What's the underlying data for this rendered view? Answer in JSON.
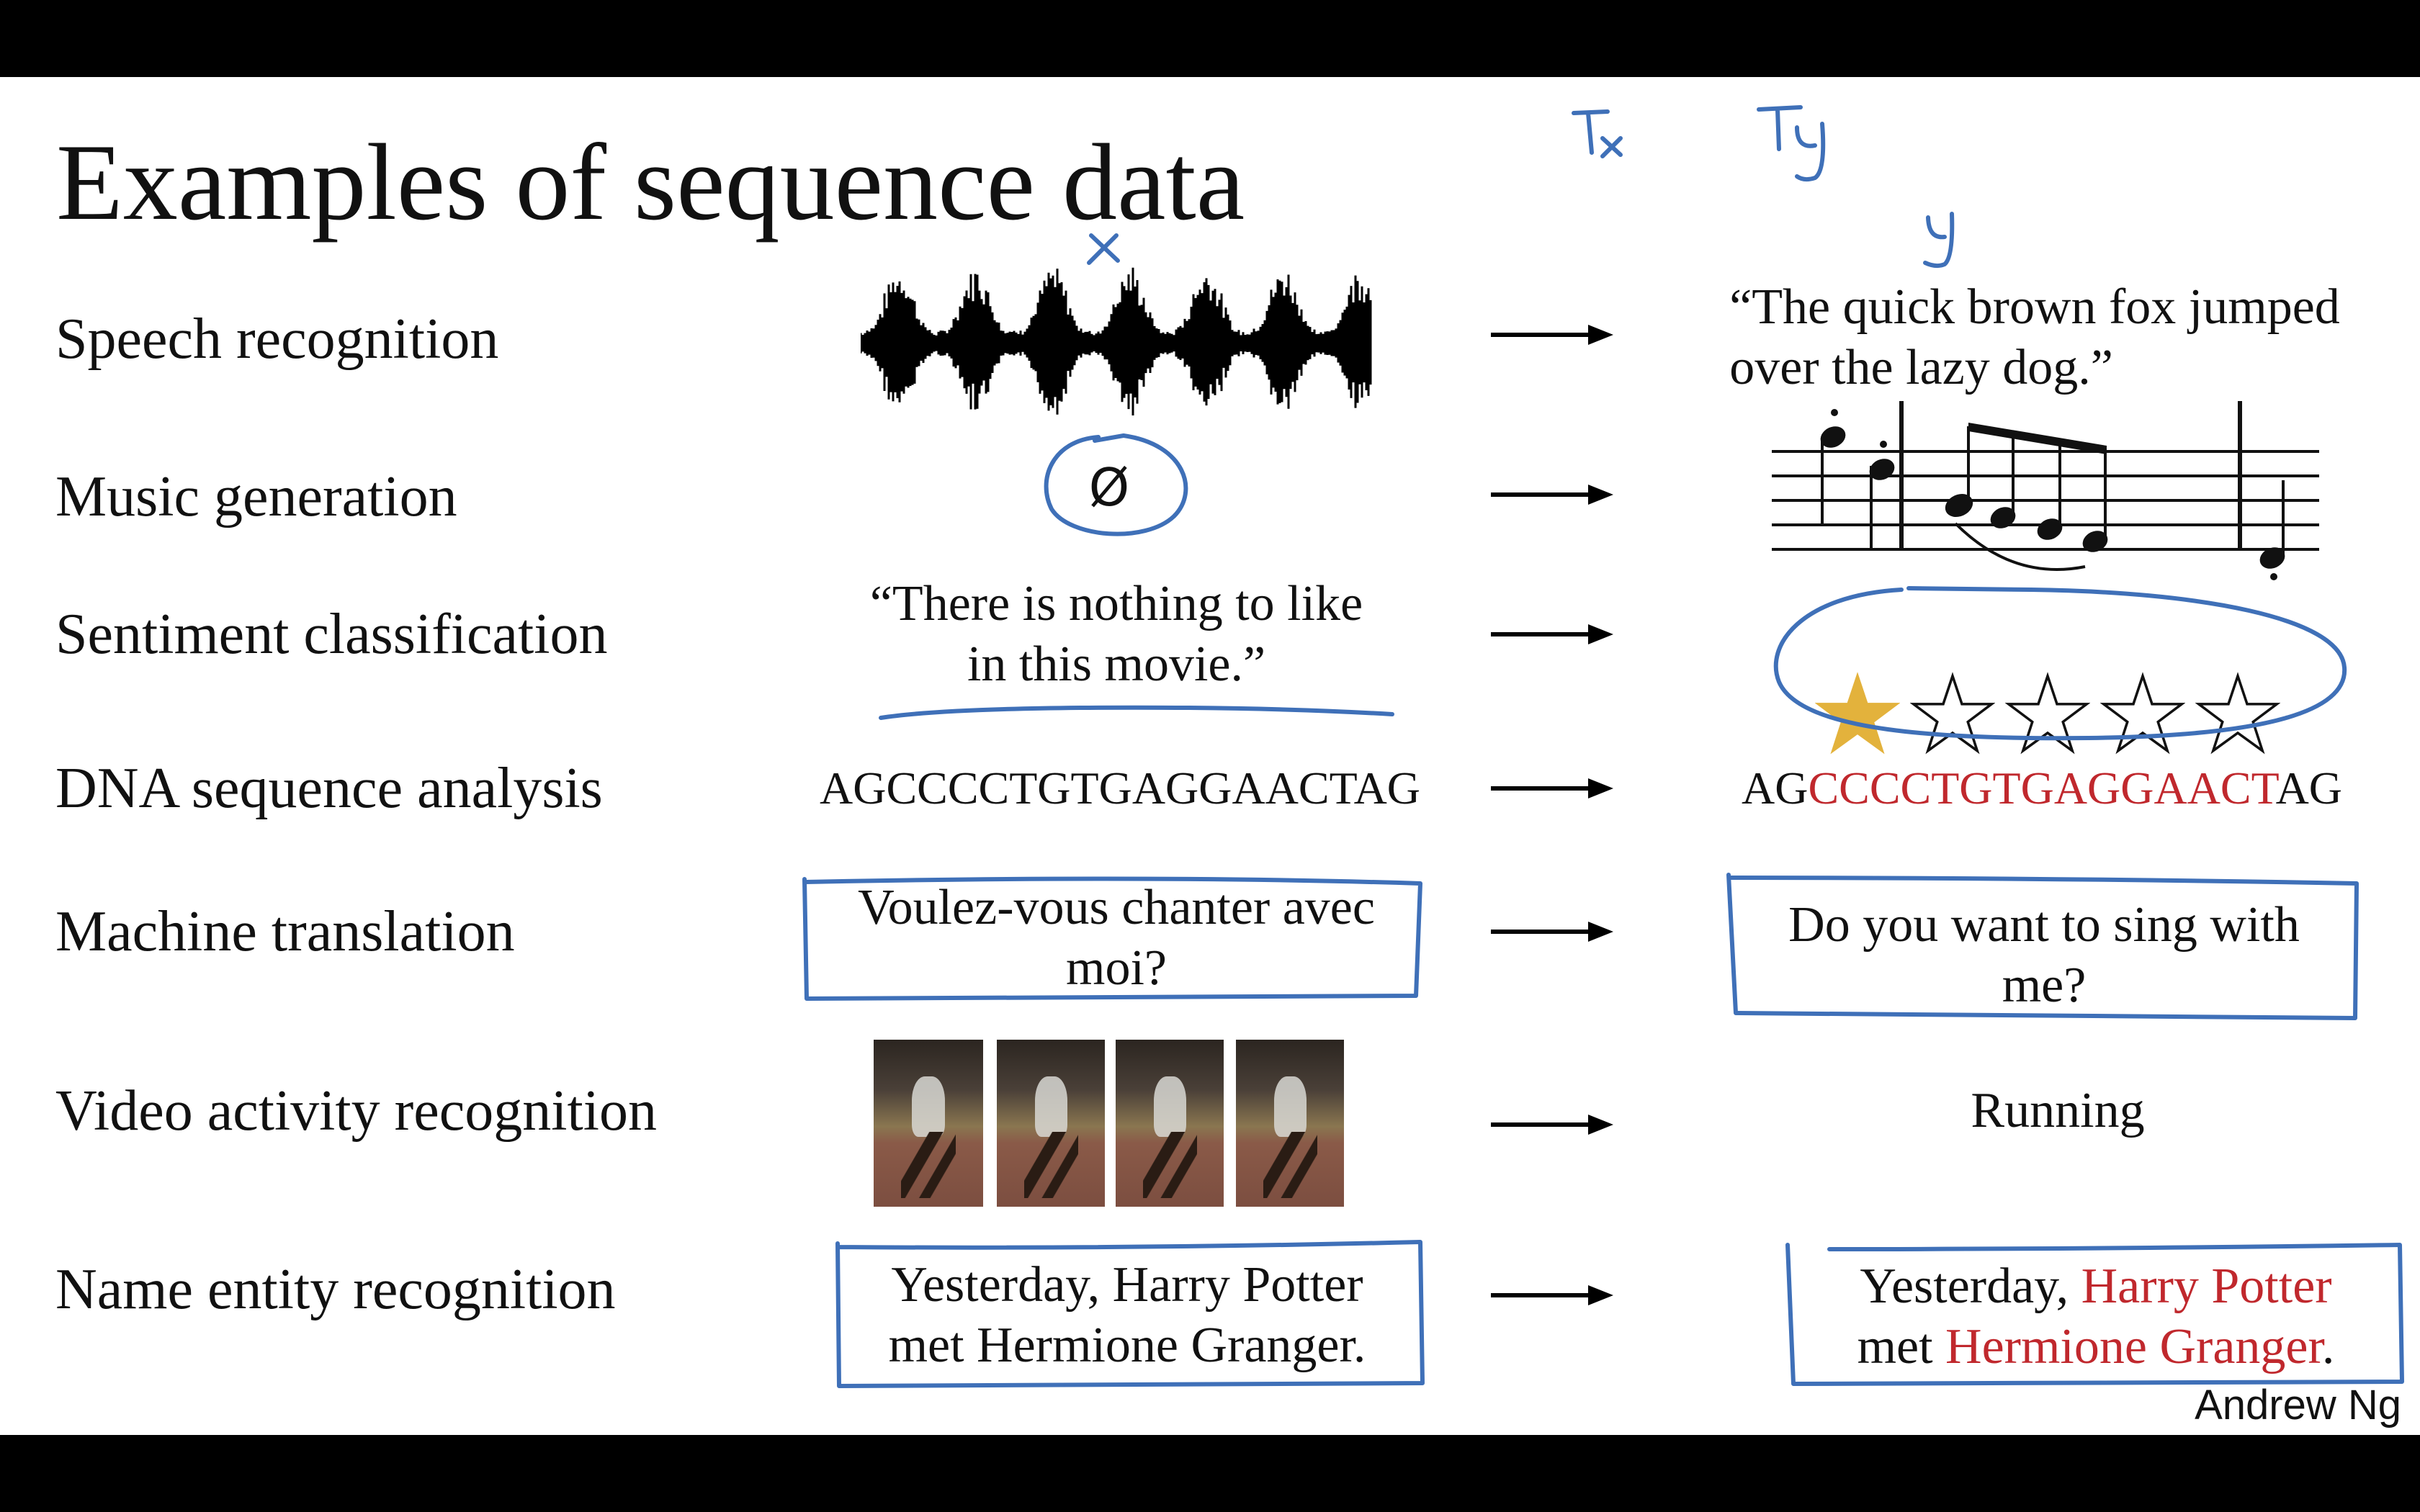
{
  "slide": {
    "title": "Examples of sequence data",
    "watermark": "Andrew Ng",
    "annotations": {
      "x": "x",
      "y": "y",
      "tx": "Tx",
      "ty": "Ty",
      "null_symbol": "Ø"
    },
    "rows": [
      {
        "label": "Speech recognition",
        "input": "[audio waveform]",
        "output_line1": "“The quick brown fox jumped",
        "output_line2": "over the lazy dog.”"
      },
      {
        "label": "Music generation",
        "input": "Ø",
        "output": "[music notation]"
      },
      {
        "label": "Sentiment classification",
        "input_line1": "“There is nothing to like",
        "input_line2": "in this movie.”",
        "output_rating": 1,
        "output_max": 5
      },
      {
        "label": "DNA sequence analysis",
        "input": "AGCCCCTGTGAGGAACTAG",
        "output_prefix": "AG",
        "output_highlight": "CCCCTGTGAGGAACT",
        "output_suffix": "AG"
      },
      {
        "label": "Machine translation",
        "input_line1": "Voulez-vous chanter avec",
        "input_line2": "moi?",
        "output_line1": "Do you want to sing with",
        "output_line2": "me?"
      },
      {
        "label": "Video activity recognition",
        "input": "[4 video frames]",
        "output": "Running"
      },
      {
        "label": "Name entity recognition",
        "input_line1": "Yesterday, Harry Potter",
        "input_line2": "met Hermione Granger.",
        "output_a": "Yesterday, ",
        "output_b": "Harry Potter",
        "output_c": "met ",
        "output_d": "Hermione Granger",
        "output_e": "."
      }
    ]
  },
  "colors": {
    "highlight": "#c0282d",
    "pen": "#3f70b8",
    "star": "#e3b23c"
  }
}
